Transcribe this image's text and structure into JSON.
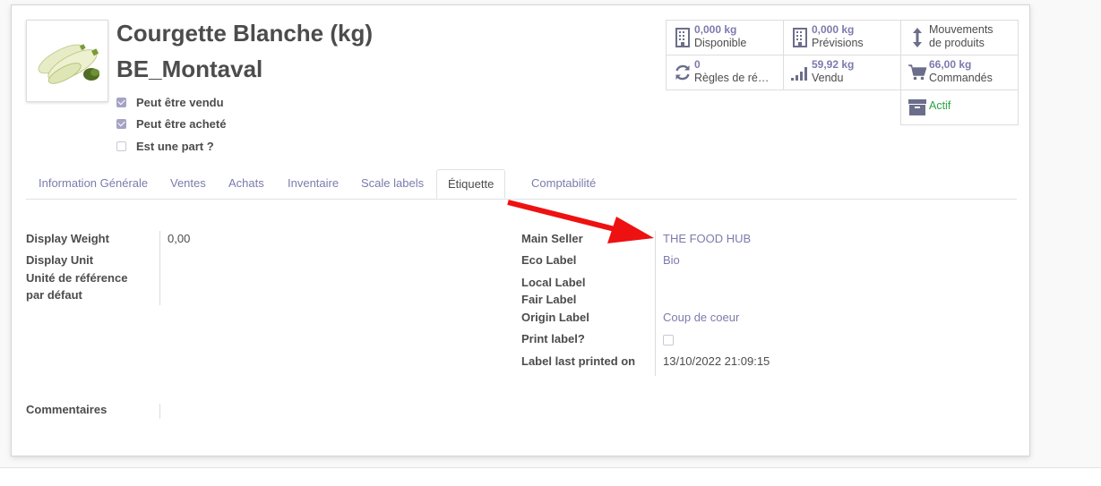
{
  "product": {
    "title_line1": "Courgette Blanche (kg)",
    "title_line2": "BE_Montaval"
  },
  "checkboxes": [
    {
      "label": "Peut être vendu",
      "checked": true
    },
    {
      "label": "Peut être acheté",
      "checked": true
    },
    {
      "label": "Est une part ?",
      "checked": false
    }
  ],
  "stats": {
    "disponible": {
      "value": "0,000 kg",
      "label": "Disponible",
      "icon": "building-icon"
    },
    "previsions": {
      "value": "0,000 kg",
      "label": "Prévisions",
      "icon": "building-icon"
    },
    "mouvements": {
      "label_line1": "Mouvements",
      "label_line2": "de produits",
      "icon": "up-down-arrow-icon"
    },
    "regles": {
      "value": "0",
      "label": "Règles de ré…",
      "icon": "refresh-icon"
    },
    "vendu": {
      "value": "59,92 kg",
      "label": "Vendu",
      "icon": "signal-bars-icon"
    },
    "commandes": {
      "value": "66,00 kg",
      "label": "Commandés",
      "icon": "cart-icon"
    },
    "actif": {
      "label": "Actif",
      "icon": "archive-icon"
    }
  },
  "tabs": [
    {
      "label": "Information Générale",
      "active": false
    },
    {
      "label": "Ventes",
      "active": false
    },
    {
      "label": "Achats",
      "active": false
    },
    {
      "label": "Inventaire",
      "active": false
    },
    {
      "label": "Scale labels",
      "active": false
    },
    {
      "label": "Étiquette",
      "active": true
    },
    {
      "label": "Comptabilité",
      "active": false
    }
  ],
  "left_fields": {
    "display_weight": {
      "label": "Display Weight",
      "value": "0,00"
    },
    "display_unit": {
      "label": "Display Unit",
      "value": ""
    },
    "unite_reference": {
      "label_line1": "Unité de référence",
      "label_line2": "par défaut",
      "value": ""
    }
  },
  "right_fields": {
    "main_seller": {
      "label": "Main Seller",
      "value": "THE FOOD HUB"
    },
    "eco_label": {
      "label": "Eco Label",
      "value": "Bio"
    },
    "local_label": {
      "label": "Local Label",
      "value": ""
    },
    "fair_label": {
      "label": "Fair Label",
      "value": ""
    },
    "origin_label": {
      "label": "Origin Label",
      "value": "Coup de coeur"
    },
    "print_label": {
      "label": "Print label?",
      "checked": false
    },
    "label_last_printed": {
      "label": "Label last printed on",
      "value": "13/10/2022 21:09:15"
    }
  },
  "comments": {
    "label": "Commentaires",
    "value": ""
  },
  "colors": {
    "accent": "#7c7bad",
    "active_green": "#28a745",
    "annotation_arrow": "#ee1111"
  }
}
